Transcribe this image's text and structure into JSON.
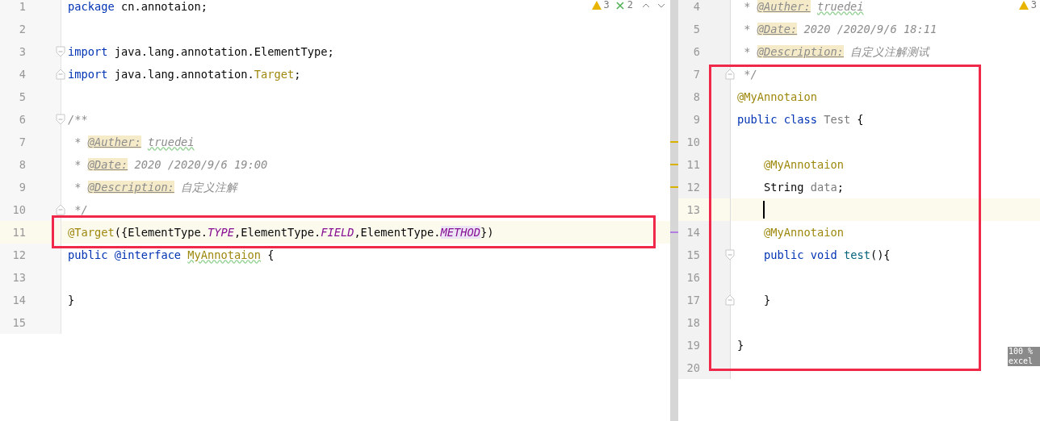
{
  "left_editor": {
    "inspections": {
      "warnings": "3",
      "typos": "2"
    },
    "lines": [
      {
        "number": "1",
        "tokens": [
          {
            "kind": "keyword",
            "text": "package"
          },
          {
            "kind": "plain",
            "text": " cn.annotaion;"
          }
        ]
      },
      {
        "number": "2"
      },
      {
        "number": "3",
        "fold_start": true,
        "tokens": [
          {
            "kind": "keyword",
            "text": "import"
          },
          {
            "kind": "plain",
            "text": " java.lang.annotation.ElementType;"
          }
        ]
      },
      {
        "number": "4",
        "fold_end": true,
        "tokens": [
          {
            "kind": "keyword",
            "text": "import"
          },
          {
            "kind": "plain",
            "text": " java.lang.annotation."
          },
          {
            "kind": "annotation",
            "text": "Target"
          },
          {
            "kind": "plain",
            "text": ";"
          }
        ]
      },
      {
        "number": "5"
      },
      {
        "number": "6",
        "fold_start": true,
        "tokens": [
          {
            "kind": "comment",
            "text": "/**"
          }
        ]
      },
      {
        "number": "7",
        "tokens": [
          {
            "kind": "comment",
            "text": " * "
          },
          {
            "kind": "doctag",
            "text": "@Auther:"
          },
          {
            "kind": "typo",
            "text": "truedei",
            "space_before": true
          }
        ]
      },
      {
        "number": "8",
        "tokens": [
          {
            "kind": "comment",
            "text": " * "
          },
          {
            "kind": "doctag",
            "text": "@Date:"
          },
          {
            "kind": "comment",
            "text": " 2020 /2020/9/6 19:00"
          }
        ]
      },
      {
        "number": "9",
        "tokens": [
          {
            "kind": "comment",
            "text": " * "
          },
          {
            "kind": "doctag",
            "text": "@Description:"
          },
          {
            "kind": "comment",
            "text": " 自定义注解"
          }
        ]
      },
      {
        "number": "10",
        "fold_end": true,
        "tokens": [
          {
            "kind": "comment",
            "text": " */"
          }
        ]
      },
      {
        "number": "11",
        "current": true,
        "tokens": [
          {
            "kind": "annotation",
            "text": "@Target"
          },
          {
            "kind": "plain",
            "text": "({ElementType."
          },
          {
            "kind": "constant",
            "text": "TYPE"
          },
          {
            "kind": "plain",
            "text": ",ElementType."
          },
          {
            "kind": "constant",
            "text": "FIELD"
          },
          {
            "kind": "plain",
            "text": ",ElementType."
          },
          {
            "kind": "constant-highlight",
            "text": "METHOD"
          },
          {
            "kind": "plain",
            "text": "})"
          }
        ]
      },
      {
        "number": "12",
        "tokens": [
          {
            "kind": "keyword",
            "text": "public"
          },
          {
            "kind": "keyword",
            "text": "@interface",
            "space_before": true
          },
          {
            "kind": "annotation-typo",
            "text": "MyAnnotaion",
            "space_before": true
          },
          {
            "kind": "plain",
            "text": " {"
          }
        ]
      },
      {
        "number": "13"
      },
      {
        "number": "14",
        "tokens": [
          {
            "kind": "plain",
            "text": "}"
          }
        ]
      },
      {
        "number": "15"
      }
    ]
  },
  "right_editor": {
    "inspections": {
      "warnings": "3"
    },
    "lines": [
      {
        "number": "4",
        "tokens": [
          {
            "kind": "comment",
            "text": " * "
          },
          {
            "kind": "doctag",
            "text": "@Auther:"
          },
          {
            "kind": "typo",
            "text": "truedei",
            "space_before": true
          }
        ]
      },
      {
        "number": "5",
        "tokens": [
          {
            "kind": "comment",
            "text": " * "
          },
          {
            "kind": "doctag",
            "text": "@Date:"
          },
          {
            "kind": "comment",
            "text": " 2020 /2020/9/6 18:11"
          }
        ]
      },
      {
        "number": "6",
        "tokens": [
          {
            "kind": "comment",
            "text": " * "
          },
          {
            "kind": "doctag",
            "text": "@Description:"
          },
          {
            "kind": "comment",
            "text": " 自定义注解测试"
          }
        ]
      },
      {
        "number": "7",
        "fold_end": true,
        "tokens": [
          {
            "kind": "comment",
            "text": " */"
          }
        ]
      },
      {
        "number": "8",
        "tokens": [
          {
            "kind": "annotation",
            "text": "@MyAnnotaion"
          }
        ]
      },
      {
        "number": "9",
        "tokens": [
          {
            "kind": "keyword",
            "text": "public"
          },
          {
            "kind": "keyword",
            "text": "class",
            "space_before": true
          },
          {
            "kind": "unused",
            "text": "Test",
            "space_before": true
          },
          {
            "kind": "plain",
            "text": " {"
          }
        ]
      },
      {
        "number": "10",
        "changed": true
      },
      {
        "number": "11",
        "changed": true,
        "indented": true,
        "tokens": [
          {
            "kind": "annotation",
            "text": "@MyAnnotaion"
          }
        ]
      },
      {
        "number": "12",
        "changed": true,
        "indented": true,
        "tokens": [
          {
            "kind": "plain",
            "text": "String "
          },
          {
            "kind": "unused",
            "text": "data"
          },
          {
            "kind": "plain",
            "text": ";"
          }
        ]
      },
      {
        "number": "13",
        "current": true,
        "caret": true,
        "indented": true
      },
      {
        "number": "14",
        "added": true,
        "indented": true,
        "tokens": [
          {
            "kind": "annotation",
            "text": "@MyAnnotaion"
          }
        ]
      },
      {
        "number": "15",
        "fold_start": true,
        "indented": true,
        "tokens": [
          {
            "kind": "keyword",
            "text": "public"
          },
          {
            "kind": "keyword",
            "text": "void",
            "space_before": true
          },
          {
            "kind": "method",
            "text": "test",
            "space_before": true
          },
          {
            "kind": "plain",
            "text": "(){"
          }
        ]
      },
      {
        "number": "16"
      },
      {
        "number": "17",
        "fold_end": true,
        "indented": true,
        "tokens": [
          {
            "kind": "plain",
            "text": "}"
          }
        ]
      },
      {
        "number": "18"
      },
      {
        "number": "19",
        "tokens": [
          {
            "kind": "plain",
            "text": "}"
          }
        ]
      },
      {
        "number": "20"
      }
    ]
  },
  "overlay_badge": {
    "lines": [
      "100 %",
      "excel"
    ]
  }
}
